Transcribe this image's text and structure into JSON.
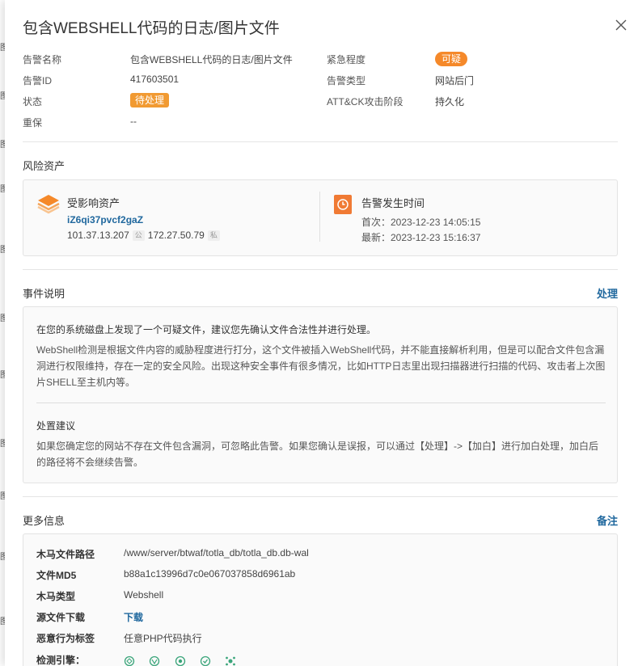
{
  "backdrop": {
    "glyphs": [
      "图",
      "图",
      "图",
      "图",
      "图",
      "图",
      "图",
      "图",
      "图",
      "图",
      "图"
    ]
  },
  "header": {
    "title": "包含WEBSHELL代码的日志/图片文件",
    "close_icon": "close-icon"
  },
  "meta": {
    "name_label": "告警名称",
    "name_value": "包含WEBSHELL代码的日志/图片文件",
    "urgency_label": "紧急程度",
    "urgency_value": "可疑",
    "id_label": "告警ID",
    "id_value": "417603501",
    "type_label": "告警类型",
    "type_value": "网站后门",
    "status_label": "状态",
    "status_value": "待处理",
    "attck_label": "ATT&CK攻击阶段",
    "attck_value": "持久化",
    "baoxian_label": "重保",
    "baoxian_value": "--"
  },
  "risk_assets": {
    "section_title": "风险资产",
    "affected_title": "受影响资产",
    "asset_name": "iZ6qi37pvcf2gaZ",
    "public_ip": "101.37.13.207",
    "public_badge": "公",
    "private_ip": "172.27.50.79",
    "private_badge": "私",
    "time_title": "告警发生时间",
    "first_time": "首次：2023-12-23 14:05:15",
    "last_time": "最新：2023-12-23 15:16:37",
    "colors": {
      "asset_icon": "#f5892a",
      "time_icon": "#f07a34"
    }
  },
  "event": {
    "section_title": "事件说明",
    "action": "处理",
    "intro": "在您的系统磁盘上发现了一个可疑文件，建议您先确认文件合法性并进行处理。",
    "description": "WebShell检测是根据文件内容的威胁程度进行打分，这个文件被插入WebShell代码，并不能直接解析利用，但是可以配合文件包含漏洞进行权限维持，存在一定的安全风险。出现这种安全事件有很多情况，比如HTTP日志里出现扫描器进行扫描的代码、攻击者上次图片SHELL至主机内等。",
    "suggestion_title": "处置建议",
    "suggestion": "如果您确定您的网站不存在文件包含漏洞，可忽略此告警。如果您确认是误报，可以通过【处理】->【加白】进行加白处理，加白后的路径将不会继续告警。"
  },
  "more_info": {
    "section_title": "更多信息",
    "action": "备注",
    "rows": [
      {
        "label": "木马文件路径",
        "value": "/www/server/btwaf/totla_db/totla_db.db-wal"
      },
      {
        "label": "文件MD5",
        "value": "b88a1c13996d7c0e067037858d6961ab"
      },
      {
        "label": "木马类型",
        "value": "Webshell"
      },
      {
        "label": "源文件下载",
        "value": "下载"
      },
      {
        "label": "恶意行为标签",
        "value": "任意PHP代码执行"
      },
      {
        "label": "检测引擎：",
        "value": ""
      }
    ],
    "engine_icons": [
      "engine-icon-1",
      "engine-icon-2",
      "engine-icon-3",
      "engine-icon-4",
      "engine-icon-5"
    ]
  },
  "colors": {
    "link": "#20689e",
    "status_tag": "#f19a32",
    "urgency_tag": "#f5892a"
  }
}
